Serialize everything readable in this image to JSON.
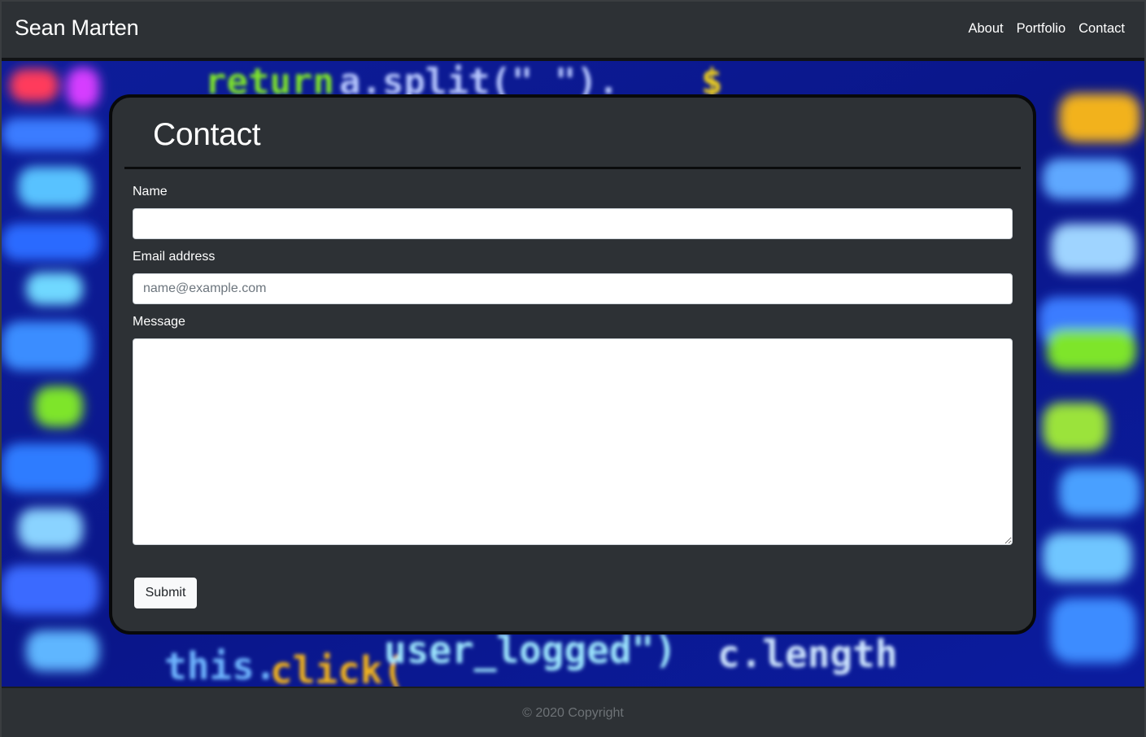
{
  "navbar": {
    "brand": "Sean Marten",
    "links": [
      {
        "label": "About"
      },
      {
        "label": "Portfolio"
      },
      {
        "label": "Contact"
      }
    ]
  },
  "hero": {
    "background_description_colors": {
      "base": "#0a1a8a",
      "accent_blue": "#2a6bff",
      "accent_cyan": "#6fd8ff",
      "accent_yellow": "#f2b21a",
      "accent_green": "#7ee52a",
      "accent_red": "#ff4a4a"
    }
  },
  "contact": {
    "title": "Contact",
    "fields": {
      "name": {
        "label": "Name",
        "value": "",
        "placeholder": ""
      },
      "email": {
        "label": "Email address",
        "value": "",
        "placeholder": "name@example.com"
      },
      "message": {
        "label": "Message",
        "value": "",
        "placeholder": ""
      }
    },
    "submit_label": "Submit"
  },
  "footer": {
    "copyright": "© 2020 Copyright"
  },
  "colors": {
    "panel": "#2d3135",
    "card_border": "#08090a",
    "text": "#ffffff",
    "muted": "#6d7276"
  }
}
